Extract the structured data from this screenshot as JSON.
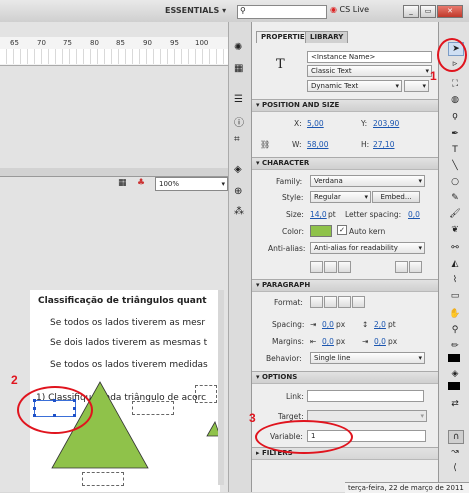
{
  "topbar": {
    "workspace": "ESSENTIALS",
    "search_icon": "search-icon",
    "cs_live": "CS Live",
    "window_buttons": [
      "_",
      "▭",
      "✕"
    ]
  },
  "ruler": {
    "ticks": [
      "65",
      "70",
      "75",
      "80",
      "85",
      "90",
      "95",
      "100"
    ]
  },
  "stage": {
    "zoom": "100%"
  },
  "document": {
    "title": "Classificação de triângulos quant",
    "lines": [
      "Se todos os lados tiverem as mesr",
      "Se dois lados tiverem as mesmas t",
      "Se todos os lados tiverem medidas"
    ],
    "question": "1) Classifique cada triângulo de acorc",
    "triangle_color": "#8fc24a"
  },
  "panel": {
    "tabs": [
      "PROPERTIES",
      "LIBRARY"
    ],
    "instance_name_placeholder": "<Instance Name>",
    "text_type": "Classic Text",
    "text_mode": "Dynamic Text",
    "position_size": {
      "header": "POSITION AND SIZE",
      "x_label": "X:",
      "x": "5,00",
      "y_label": "Y:",
      "y": "203,90",
      "w_label": "W:",
      "w": "58,00",
      "h_label": "H:",
      "h": "27,10"
    },
    "character": {
      "header": "CHARACTER",
      "family_label": "Family:",
      "family": "Verdana",
      "style_label": "Style:",
      "style": "Regular",
      "embed": "Embed...",
      "size_label": "Size:",
      "size": "14,0",
      "size_unit": "pt",
      "letter_spacing_label": "Letter spacing:",
      "letter_spacing": "0,0",
      "color_label": "Color:",
      "color": "#8fc24a",
      "auto_kern": "Auto kern",
      "antialias_label": "Anti-alias:",
      "antialias": "Anti-alias for readability"
    },
    "paragraph": {
      "header": "PARAGRAPH",
      "format_label": "Format:",
      "spacing_label": "Spacing:",
      "spacing_indent": "0,0",
      "spacing_indent_unit": "px",
      "spacing_line": "2,0",
      "spacing_line_unit": "pt",
      "margins_label": "Margins:",
      "margin_left": "0,0",
      "margin_left_unit": "px",
      "margin_right": "0,0",
      "margin_right_unit": "px",
      "behavior_label": "Behavior:",
      "behavior": "Single line"
    },
    "options": {
      "header": "OPTIONS",
      "link_label": "Link:",
      "target_label": "Target:",
      "variable_label": "Variable:",
      "variable": "1"
    },
    "filters": {
      "header": "FILTERS"
    }
  },
  "annotations": {
    "one": "1",
    "two": "2",
    "three": "3"
  },
  "taskbar": {
    "date": "terça-feira, 22 de março de 2011"
  }
}
